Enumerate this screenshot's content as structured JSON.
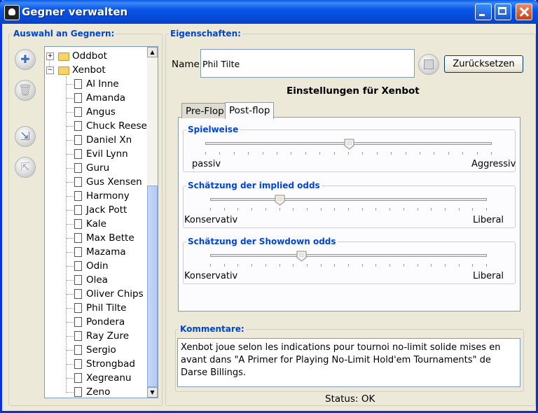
{
  "window": {
    "title": "Gegner verwalten"
  },
  "left_panel": {
    "title": "Auswahl an Gegnern:",
    "tree": {
      "folders": [
        {
          "label": "Oddbot",
          "expanded": false
        },
        {
          "label": "Xenbot",
          "expanded": true
        }
      ],
      "items": [
        "Al Inne",
        "Amanda",
        "Angus",
        "Chuck Reese",
        "Daniel Xn",
        "Evil Lynn",
        "Guru",
        "Gus Xensen",
        "Harmony",
        "Jack Pott",
        "Kale",
        "Max Bette",
        "Mazama",
        "Odin",
        "Olea",
        "Oliver Chips",
        "Phil Tilte",
        "Pondera",
        "Ray Zure",
        "Sergio",
        "Strongbad",
        "Xegreanu",
        "Zeno"
      ]
    },
    "buttons": [
      {
        "icon": "plus-icon",
        "enabled": true
      },
      {
        "icon": "trash-icon",
        "enabled": false
      },
      {
        "icon": "import-icon",
        "enabled": true
      },
      {
        "icon": "export-icon",
        "enabled": false
      }
    ]
  },
  "properties": {
    "title": "Eigenschaften:",
    "name_label": "Name:",
    "name_value": "Phil Tilte",
    "reset_label": "Zurücksetzen",
    "settings_heading": "Einstellungen für Xenbot",
    "tabs": [
      {
        "label": "Pre-Flop",
        "active": false
      },
      {
        "label": "Post-flop",
        "active": true
      }
    ],
    "sliders": [
      {
        "title": "Spielweise",
        "min_label": "passiv",
        "max_label": "Aggressiv",
        "value": 0.5
      },
      {
        "title": "Schätzung der implied odds",
        "min_label": "Konservativ",
        "max_label": "Liberal",
        "value": 0.25
      },
      {
        "title": "Schätzung der Showdown odds",
        "min_label": "Konservativ",
        "max_label": "Liberal",
        "value": 0.33
      }
    ],
    "comments_title": "Kommentare:",
    "comments_text": "Xenbot joue selon les indications pour tournoi no-limit solide mises en avant dans \"A Primer for Playing No-Limit Hold'em Tournaments\" de Darse Billings."
  },
  "status": "Status: OK"
}
